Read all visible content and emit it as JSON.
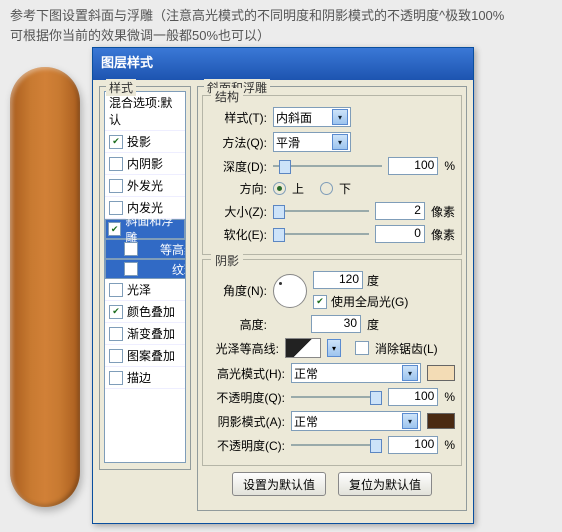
{
  "caption": {
    "line1": "参考下图设置斜面与浮雕（注意高光模式的不同明度和阴影模式的不透明度^极致100%",
    "line2": "可根据你当前的效果微调一般都50%也可以）"
  },
  "dialog": {
    "title": "图层样式",
    "styles_group": "样式",
    "blend_opts": "混合选项:默认",
    "list": {
      "drop_shadow": "投影",
      "inner_shadow": "内阴影",
      "outer_glow": "外发光",
      "inner_glow": "内发光",
      "bevel": "斜面和浮雕",
      "contour": "等高线",
      "texture": "纹理",
      "satin": "光泽",
      "color_overlay": "颜色叠加",
      "gradient_overlay": "渐变叠加",
      "pattern_overlay": "图案叠加",
      "stroke": "描边"
    },
    "panel": {
      "heading": "斜面和浮雕",
      "structure": "结构",
      "style_l": "样式(T):",
      "style_v": "内斜面",
      "tech_l": "方法(Q):",
      "tech_v": "平滑",
      "depth_l": "深度(D):",
      "depth_v": "100",
      "pct": "%",
      "dir_l": "方向:",
      "up": "上",
      "down": "下",
      "size_l": "大小(Z):",
      "size_v": "2",
      "soften_l": "软化(E):",
      "soften_v": "0",
      "px": "像素",
      "shading": "阴影",
      "angle_l": "角度(N):",
      "angle_v": "120",
      "deg": "度",
      "global_l": "使用全局光(G)",
      "alt_l": "高度:",
      "alt_v": "30",
      "gloss_l": "光泽等高线:",
      "anti_l": "消除锯齿(L)",
      "hl_mode_l": "高光模式(H):",
      "hl_mode_v": "正常",
      "hl_op_l": "不透明度(Q):",
      "hl_op_v": "100",
      "sh_mode_l": "阴影模式(A):",
      "sh_mode_v": "正常",
      "sh_op_l": "不透明度(C):",
      "sh_op_v": "100",
      "btn_default": "设置为默认值",
      "btn_reset": "复位为默认值"
    },
    "colors": {
      "hl_swatch": "#f3dcb5",
      "sh_swatch": "#4a2a12"
    }
  }
}
